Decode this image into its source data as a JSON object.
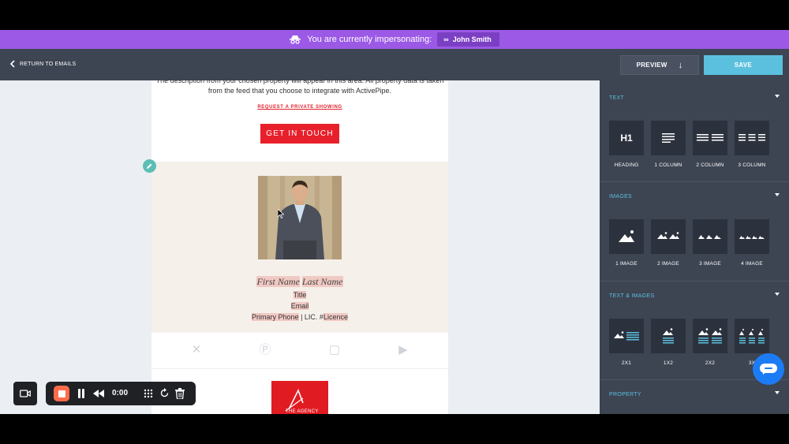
{
  "impersonation": {
    "message": "You are currently impersonating:",
    "user": "John Smith"
  },
  "header": {
    "back_label": "RETURN TO EMAILS",
    "preview_label": "PREVIEW",
    "save_label": "SAVE"
  },
  "email": {
    "description": "The description from your chosen property will appear in this area. All property data is taken from the feed that you choose to integrate with ActivePipe.",
    "request_link": "REQUEST A PRIVATE SHOWING",
    "cta_label": "GET IN TOUCH",
    "agent": {
      "first_name": "First Name",
      "last_name": "Last Name",
      "title": "Title",
      "email": "Email",
      "phone": "Primary Phone",
      "lic_text": "| LIC. #",
      "licence": "Licence"
    },
    "logo_text": "THE AGENCY"
  },
  "sidebar": {
    "sections": [
      {
        "title": "TEXT",
        "items": [
          "HEADING",
          "1 COLUMN",
          "2 COLUMN",
          "3 COLUMN"
        ]
      },
      {
        "title": "IMAGES",
        "items": [
          "1 IMAGE",
          "2 IMAGE",
          "3 IMAGE",
          "4 IMAGE"
        ]
      },
      {
        "title": "TEXT & IMAGES",
        "items": [
          "2X1",
          "1X2",
          "2X2",
          "3X"
        ]
      },
      {
        "title": "PROPERTY",
        "items": []
      }
    ],
    "heading_glyph": "H1"
  },
  "recorder": {
    "time": "0:00"
  },
  "colors": {
    "banner": "#9b59e6",
    "header": "#3d4452",
    "accent": "#5bc0de",
    "cta": "#e8202b",
    "chat": "#1c7cf5"
  }
}
